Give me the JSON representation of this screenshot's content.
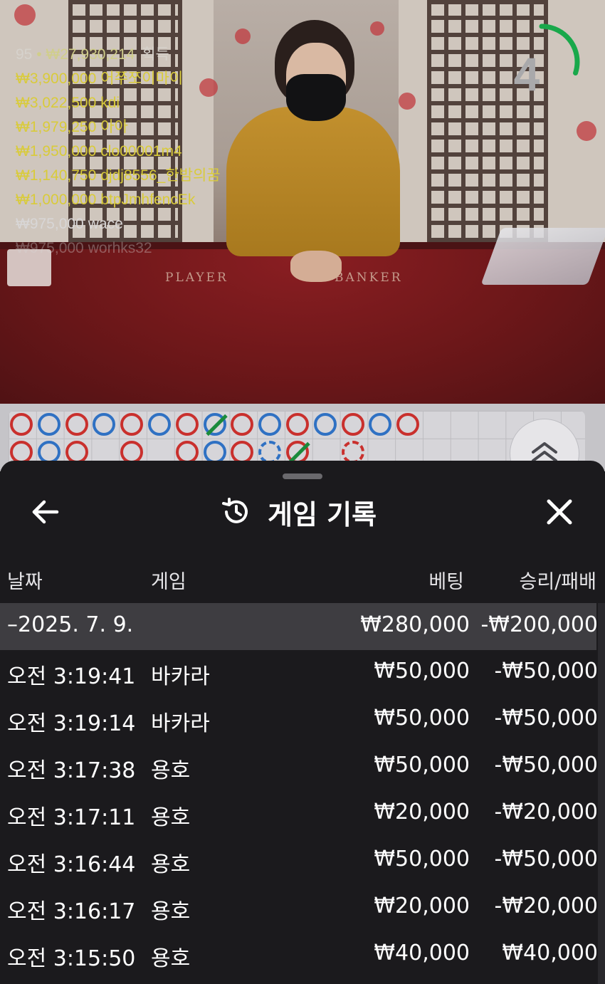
{
  "video": {
    "felt_labels": [
      "PLAYER",
      "BANKER"
    ],
    "timer": {
      "countdown": "4",
      "ring_fraction_remaining": 0.3,
      "ring_color": "#19a84b"
    },
    "winners": {
      "count": "95",
      "total": "₩27,930,214",
      "suffix": "획득",
      "rows": [
        {
          "amount": "₩3,900,000",
          "name": "어쭈쪼이마이"
        },
        {
          "amount": "₩3,022,500",
          "name": "kdi"
        },
        {
          "amount": "₩1,979,250",
          "name": "아아"
        },
        {
          "amount": "₩1,950,000",
          "name": "clo00001m4"
        },
        {
          "amount": "₩1,140,750",
          "name": "djdj8556_한밤의꿈"
        },
        {
          "amount": "₩1,000,000",
          "name": "btpJmhfencEk"
        },
        {
          "amount": "₩975,000",
          "name": "wace"
        },
        {
          "amount": "₩975,000",
          "name": "worhks32"
        }
      ]
    }
  },
  "road": {
    "colors": {
      "red": "#c9302d",
      "blue": "#2f71c3",
      "tie": "#1a8a3b"
    },
    "row1": [
      "red",
      "blue",
      "red",
      "blue",
      "red",
      "blue",
      "red",
      "blue-tie",
      "red",
      "blue",
      "red",
      "blue",
      "red",
      "blue",
      "red"
    ],
    "row2": [
      "red",
      "blue",
      "red",
      "",
      "red",
      "",
      "red",
      "blue",
      "red",
      "blue-dashed",
      "red-tie",
      "",
      "red-dashed",
      "",
      ""
    ]
  },
  "sheet": {
    "title": "게임 기록",
    "icons": {
      "back": "arrow-left-icon",
      "history": "history-icon",
      "close": "close-icon",
      "scroll_up": "chevron-double-up-icon"
    },
    "columns": {
      "date": "날짜",
      "game": "게임",
      "bet": "베팅",
      "result": "승리/패배"
    },
    "date_group": {
      "date": "–2025. 7. 9.",
      "bet": "₩280,000",
      "result": "-₩200,000"
    },
    "rows": [
      {
        "time": "오전 3:19:41",
        "game": "바카라",
        "bet": "₩50,000",
        "result": "-₩50,000"
      },
      {
        "time": "오전 3:19:14",
        "game": "바카라",
        "bet": "₩50,000",
        "result": "-₩50,000"
      },
      {
        "time": "오전 3:17:38",
        "game": "용호",
        "bet": "₩50,000",
        "result": "-₩50,000"
      },
      {
        "time": "오전 3:17:11",
        "game": "용호",
        "bet": "₩20,000",
        "result": "-₩20,000"
      },
      {
        "time": "오전 3:16:44",
        "game": "용호",
        "bet": "₩50,000",
        "result": "-₩50,000"
      },
      {
        "time": "오전 3:16:17",
        "game": "용호",
        "bet": "₩20,000",
        "result": "-₩20,000"
      },
      {
        "time": "오전 3:15:50",
        "game": "용호",
        "bet": "₩40,000",
        "result": "₩40,000"
      }
    ]
  }
}
